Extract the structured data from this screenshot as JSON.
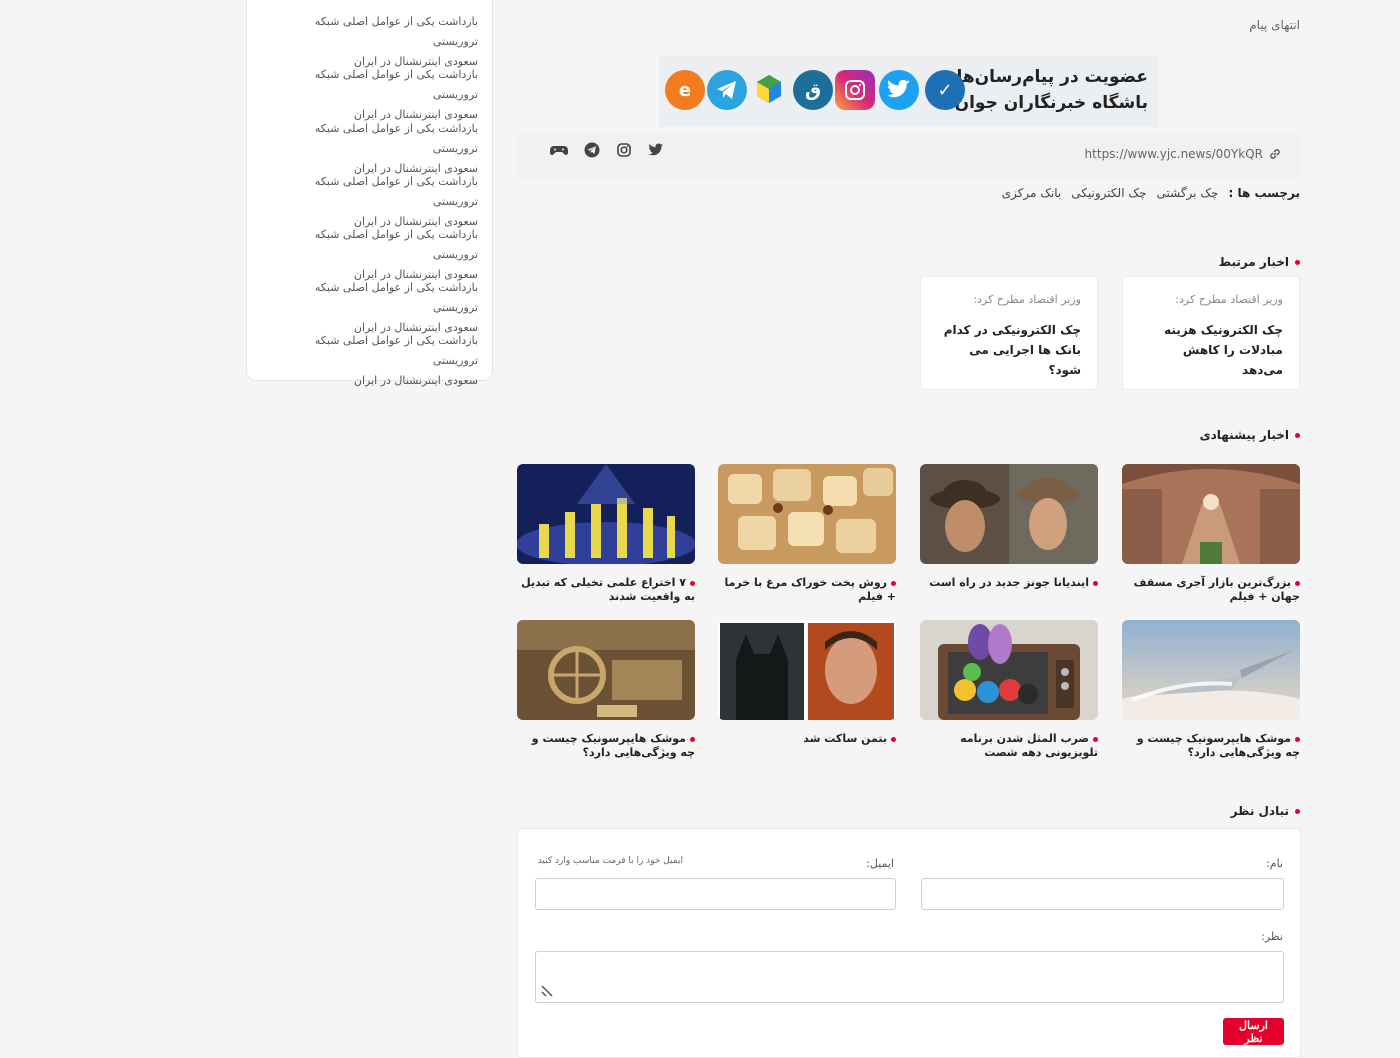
{
  "sidebar": {
    "items": [
      {
        "line1": "بازداشت یکی از عوامل اصلی شبکه تروریستی",
        "line2": "سعودی اینترنشنال در ایران"
      },
      {
        "line1": "بازداشت یکی از عوامل اصلی شبکه تروریستی",
        "line2": "سعودی اینترنشنال در ایران"
      },
      {
        "line1": "بازداشت یکی از عوامل اصلی شبکه تروریستی",
        "line2": "سعودی اینترنشنال در ایران"
      },
      {
        "line1": "بازداشت یکی از عوامل اصلی شبکه تروریستی",
        "line2": "سعودی اینترنشنال در ایران"
      },
      {
        "line1": "بازداشت یکی از عوامل اصلی شبکه تروریستی",
        "line2": "سعودی اینترنشنال در ایران"
      },
      {
        "line1": "بازداشت یکی از عوامل اصلی شبکه تروریستی",
        "line2": "سعودی اینترنشنال در ایران"
      },
      {
        "line1": "بازداشت یکی از عوامل اصلی شبکه تروریستی",
        "line2": "سعودی اینترنشنال در ایران"
      }
    ]
  },
  "article": {
    "end_message": "انتهای پیام",
    "banner": {
      "line1": "عضویت در پیام‌رسان‌های",
      "line2": "باشگاه خبرنگاران جوان"
    },
    "short_link": "https://www.yjc.news/00YkQR",
    "tags_label": "برچسب ها :",
    "tags": [
      "چک برگشتی",
      "چک الکترونیکی",
      "بانک مرکزی"
    ]
  },
  "related": {
    "title": "اخبار مرتبط",
    "items": [
      {
        "lead": "وزیر اقتصاد مطرح کرد:",
        "title": "چک الکترونیک هزینه مبادلات را کاهش می‌دهد"
      },
      {
        "lead": "وزیر اقتصاد مطرح کرد:",
        "title": "چک الکترونیکی در کدام بانک ها اجرایی می شود؟"
      }
    ]
  },
  "suggested": {
    "title": "اخبار پیشنهادی",
    "items": [
      {
        "caption": "بزرگ‌ترین بازار آجری مسقف جهان + فیلم"
      },
      {
        "caption": "ایندیانا جونز جدید در راه است"
      },
      {
        "caption": "روش پخت خوراک مرغ با خرما + فیلم"
      },
      {
        "caption": "۷ اختراع علمی تخیلی که تبدیل به واقعیت شدند"
      },
      {
        "caption": "موشک هایپرسونیک چیست و چه ویژگی‌هایی دارد؟"
      },
      {
        "caption": "ضرب المثل شدن برنامه تلویزیونی دهه شصت"
      },
      {
        "caption": "بتمن ساکت شد"
      },
      {
        "caption": "موشک هایپرسونیک چیست و چه ویژگی‌هایی دارد؟"
      }
    ]
  },
  "comments": {
    "title": "تبادل نظر",
    "name_label": "نام:",
    "email_label": "ایمیل:",
    "email_hint": "ایمیل خود را با فرمت مناسب وارد کنید",
    "comment_label": "نظر:",
    "submit_label": "ارسال نظر"
  },
  "colors": {
    "accent": "#e4002b",
    "background": "#f5f5f5"
  }
}
